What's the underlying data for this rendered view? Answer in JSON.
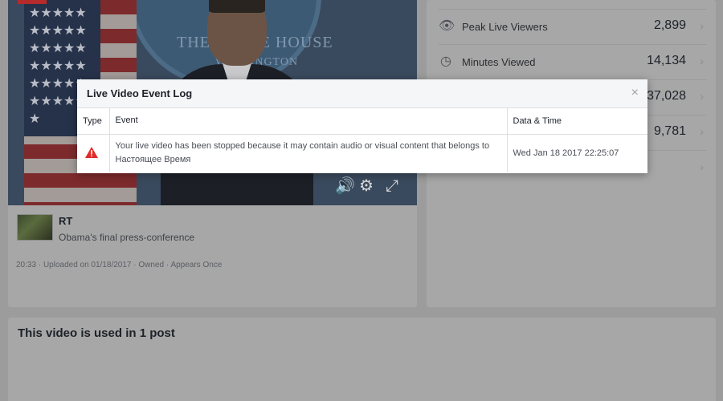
{
  "video": {
    "seal_text": "THE WHITE HOUSE",
    "seal_subtext": "WASHINGTON",
    "channel": "RT",
    "title": "Obama's final press-conference",
    "duration": "20:33",
    "uploaded": "Uploaded on 01/18/2017",
    "ownership": "Owned",
    "appearances": "Appears Once",
    "separator": "·"
  },
  "stats": [
    {
      "icon": "eye-icon",
      "label": "Peak Live Viewers",
      "value": "2,899"
    },
    {
      "icon": "clock-icon",
      "label": "Minutes Viewed",
      "value": "14,134"
    },
    {
      "icon": "",
      "label": "",
      "value": "37,028"
    },
    {
      "icon": "",
      "label": "",
      "value": "9,781"
    },
    {
      "icon": "",
      "label": "",
      "value": ""
    }
  ],
  "posts": {
    "title": "This video is used in 1 post"
  },
  "modal": {
    "title": "Live Video Event Log",
    "close_glyph": "×",
    "columns": {
      "type": "Type",
      "event": "Event",
      "datetime": "Data & Time"
    },
    "rows": [
      {
        "type_icon": "warning-icon",
        "event": "Your live video has been stopped because it may contain audio or visual content that belongs to Настоящее Время",
        "datetime": "Wed Jan 18 2017 22:25:07"
      }
    ]
  },
  "colors": {
    "overlay": "#9c9c9c",
    "accent_link": "#4267b2",
    "warning": "#e02b27"
  }
}
